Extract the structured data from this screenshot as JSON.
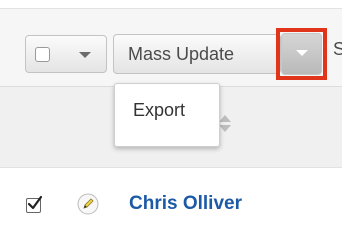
{
  "toolbar": {
    "mass_update_label": "Mass Update",
    "next_label_partial": "S"
  },
  "actions_menu": {
    "items": [
      {
        "label": "Export"
      }
    ]
  },
  "records": [
    {
      "name": "Chris Olliver",
      "checked": true
    }
  ],
  "colors": {
    "highlight": "#e0351b",
    "link": "#1d5aa6"
  },
  "icons": [
    "checkbox-icon",
    "chevron-down-icon",
    "sort-icon",
    "pencil-icon",
    "checkmark-icon"
  ]
}
